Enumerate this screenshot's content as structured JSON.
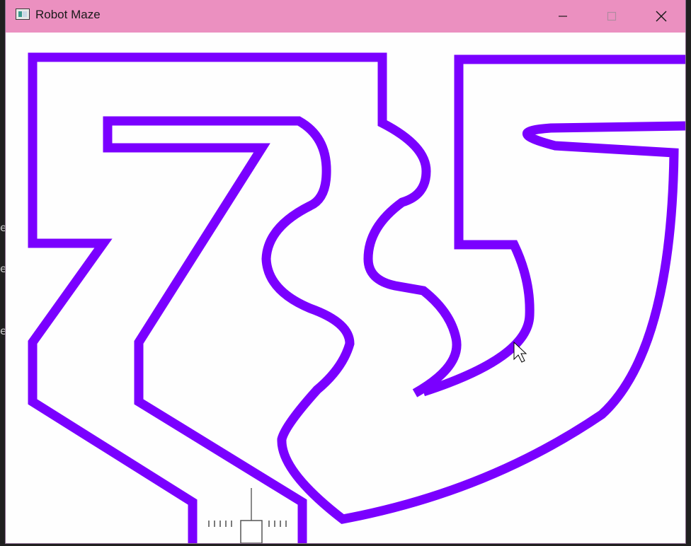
{
  "window": {
    "title": "Robot Maze",
    "icon": "app-window-icon",
    "controls": {
      "minimize_icon": "minimize-icon",
      "maximize_icon": "maximize-icon",
      "close_icon": "close-icon"
    }
  },
  "colors": {
    "titlebar": "#eb90c0",
    "maze_wall": "#7a00ff",
    "canvas_bg": "#fefefe",
    "robot": "#555555"
  },
  "background_fragments": [
    "e",
    "e",
    "e"
  ],
  "maze": {
    "wall_count": 4
  },
  "robot": {
    "sensor_icon": "robot-sensor-icon"
  },
  "cursor": {
    "icon": "mouse-pointer-icon"
  }
}
